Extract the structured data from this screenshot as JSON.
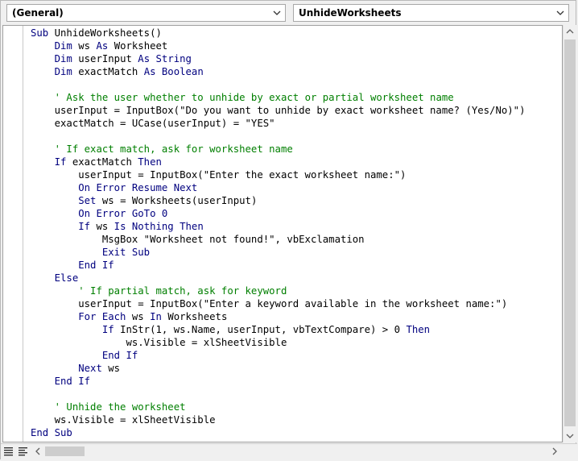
{
  "dropdowns": {
    "object": "(General)",
    "procedure": "UnhideWorksheets"
  },
  "code_lines": [
    [
      {
        "t": "kw",
        "v": "Sub "
      },
      {
        "t": "n",
        "v": "UnhideWorksheets()"
      }
    ],
    [
      {
        "t": "n",
        "v": "    "
      },
      {
        "t": "kw",
        "v": "Dim "
      },
      {
        "t": "n",
        "v": "ws "
      },
      {
        "t": "kw",
        "v": "As "
      },
      {
        "t": "n",
        "v": "Worksheet"
      }
    ],
    [
      {
        "t": "n",
        "v": "    "
      },
      {
        "t": "kw",
        "v": "Dim "
      },
      {
        "t": "n",
        "v": "userInput "
      },
      {
        "t": "kw",
        "v": "As String"
      }
    ],
    [
      {
        "t": "n",
        "v": "    "
      },
      {
        "t": "kw",
        "v": "Dim "
      },
      {
        "t": "n",
        "v": "exactMatch "
      },
      {
        "t": "kw",
        "v": "As Boolean"
      }
    ],
    [
      {
        "t": "n",
        "v": ""
      }
    ],
    [
      {
        "t": "n",
        "v": "    "
      },
      {
        "t": "cm",
        "v": "' Ask the user whether to unhide by exact or partial worksheet name"
      }
    ],
    [
      {
        "t": "n",
        "v": "    userInput = InputBox(\"Do you want to unhide by exact worksheet name? (Yes/No)\")"
      }
    ],
    [
      {
        "t": "n",
        "v": "    exactMatch = UCase(userInput) = \"YES\""
      }
    ],
    [
      {
        "t": "n",
        "v": ""
      }
    ],
    [
      {
        "t": "n",
        "v": "    "
      },
      {
        "t": "cm",
        "v": "' If exact match, ask for worksheet name"
      }
    ],
    [
      {
        "t": "n",
        "v": "    "
      },
      {
        "t": "kw",
        "v": "If "
      },
      {
        "t": "n",
        "v": "exactMatch "
      },
      {
        "t": "kw",
        "v": "Then"
      }
    ],
    [
      {
        "t": "n",
        "v": "        userInput = InputBox(\"Enter the exact worksheet name:\")"
      }
    ],
    [
      {
        "t": "n",
        "v": "        "
      },
      {
        "t": "kw",
        "v": "On Error Resume Next"
      }
    ],
    [
      {
        "t": "n",
        "v": "        "
      },
      {
        "t": "kw",
        "v": "Set "
      },
      {
        "t": "n",
        "v": "ws = Worksheets(userInput)"
      }
    ],
    [
      {
        "t": "n",
        "v": "        "
      },
      {
        "t": "kw",
        "v": "On Error GoTo 0"
      }
    ],
    [
      {
        "t": "n",
        "v": "        "
      },
      {
        "t": "kw",
        "v": "If "
      },
      {
        "t": "n",
        "v": "ws "
      },
      {
        "t": "kw",
        "v": "Is Nothing Then"
      }
    ],
    [
      {
        "t": "n",
        "v": "            MsgBox \"Worksheet not found!\", vbExclamation"
      }
    ],
    [
      {
        "t": "n",
        "v": "            "
      },
      {
        "t": "kw",
        "v": "Exit Sub"
      }
    ],
    [
      {
        "t": "n",
        "v": "        "
      },
      {
        "t": "kw",
        "v": "End If"
      }
    ],
    [
      {
        "t": "n",
        "v": "    "
      },
      {
        "t": "kw",
        "v": "Else"
      }
    ],
    [
      {
        "t": "n",
        "v": "        "
      },
      {
        "t": "cm",
        "v": "' If partial match, ask for keyword"
      }
    ],
    [
      {
        "t": "n",
        "v": "        userInput = InputBox(\"Enter a keyword available in the worksheet name:\")"
      }
    ],
    [
      {
        "t": "n",
        "v": "        "
      },
      {
        "t": "kw",
        "v": "For Each "
      },
      {
        "t": "n",
        "v": "ws "
      },
      {
        "t": "kw",
        "v": "In "
      },
      {
        "t": "n",
        "v": "Worksheets"
      }
    ],
    [
      {
        "t": "n",
        "v": "            "
      },
      {
        "t": "kw",
        "v": "If "
      },
      {
        "t": "n",
        "v": "InStr(1, ws.Name, userInput, vbTextCompare) > 0 "
      },
      {
        "t": "kw",
        "v": "Then"
      }
    ],
    [
      {
        "t": "n",
        "v": "                ws.Visible = xlSheetVisible"
      }
    ],
    [
      {
        "t": "n",
        "v": "            "
      },
      {
        "t": "kw",
        "v": "End If"
      }
    ],
    [
      {
        "t": "n",
        "v": "        "
      },
      {
        "t": "kw",
        "v": "Next "
      },
      {
        "t": "n",
        "v": "ws"
      }
    ],
    [
      {
        "t": "n",
        "v": "    "
      },
      {
        "t": "kw",
        "v": "End If"
      }
    ],
    [
      {
        "t": "n",
        "v": ""
      }
    ],
    [
      {
        "t": "n",
        "v": "    "
      },
      {
        "t": "cm",
        "v": "' Unhide the worksheet"
      }
    ],
    [
      {
        "t": "n",
        "v": "    ws.Visible = xlSheetVisible"
      }
    ],
    [
      {
        "t": "kw",
        "v": "End Sub"
      }
    ]
  ],
  "colors": {
    "keyword": "#00007f",
    "comment": "#007f00",
    "text": "#000000"
  },
  "icons": {
    "dropdown_arrow": "chevron-down-icon",
    "scroll_up": "chevron-up-icon",
    "scroll_down": "chevron-down-icon",
    "scroll_left": "chevron-left-icon",
    "scroll_right": "chevron-right-icon",
    "procedure_view": "procedure-view-icon",
    "full_module_view": "full-module-view-icon"
  }
}
